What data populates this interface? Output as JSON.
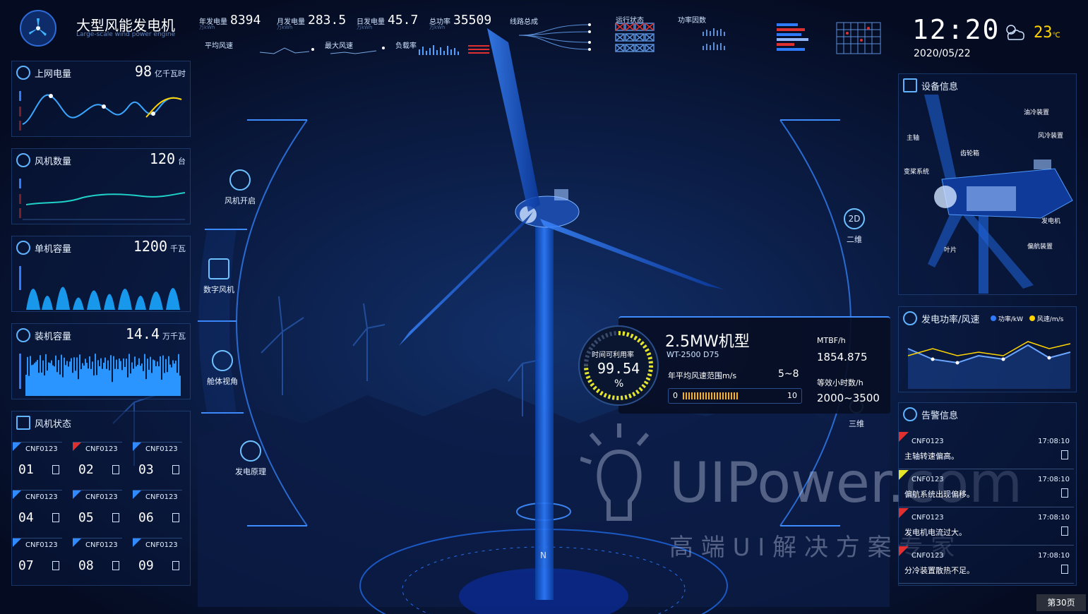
{
  "app": {
    "title": "大型风能发电机",
    "subtitle": "Large-scale wind power engine"
  },
  "topbar": {
    "metrics": [
      {
        "label": "年发电量",
        "value": "8394",
        "unit": "万kWh"
      },
      {
        "label": "月发电量",
        "value": "283.5",
        "unit": "万kWh"
      },
      {
        "label": "日发电量",
        "value": "45.7",
        "unit": "万kWh"
      },
      {
        "label": "总功率",
        "value": "35509",
        "unit": "万kWh"
      }
    ],
    "sublabels": {
      "avg_wind": "平均风速",
      "max_wind": "最大风速",
      "load_rate": "负载率"
    },
    "center_labels": {
      "line_total": "线路总成",
      "run_state": "运行状态",
      "power_factor": "功率因数"
    },
    "clock": {
      "time": "12:20",
      "date": "2020/05/22"
    },
    "weather": {
      "temp": "23",
      "unit": "℃"
    }
  },
  "left": {
    "panels": [
      {
        "title": "上网电量",
        "value": "98",
        "unit": "亿千瓦时"
      },
      {
        "title": "风机数量",
        "value": "120",
        "unit": "台"
      },
      {
        "title": "单机容量",
        "value": "1200",
        "unit": "千瓦"
      },
      {
        "title": "装机容量",
        "value": "14.4",
        "unit": "万千瓦"
      }
    ],
    "status_panel": {
      "title": "风机状态",
      "tiles": [
        {
          "id": "CNF0123",
          "num": "01",
          "flag_color": "#2f8bff"
        },
        {
          "id": "CNF0123",
          "num": "02",
          "flag_color": "#e03030"
        },
        {
          "id": "CNF0123",
          "num": "03",
          "flag_color": "#2f8bff"
        },
        {
          "id": "CNF0123",
          "num": "04",
          "flag_color": "#2f8bff"
        },
        {
          "id": "CNF0123",
          "num": "05",
          "flag_color": "#2f8bff"
        },
        {
          "id": "CNF0123",
          "num": "06",
          "flag_color": "#2f8bff"
        },
        {
          "id": "CNF0123",
          "num": "07",
          "flag_color": "#2f8bff"
        },
        {
          "id": "CNF0123",
          "num": "08",
          "flag_color": "#2f8bff"
        },
        {
          "id": "CNF0123",
          "num": "09",
          "flag_color": "#2f8bff"
        }
      ]
    }
  },
  "center": {
    "menu_left": [
      "风机开启",
      "数字风机",
      "舱体视角",
      "发电原理"
    ],
    "menu_right": [
      {
        "badge": "2D",
        "label": "二维"
      },
      {
        "badge": "",
        "label": "三维"
      }
    ],
    "card": {
      "model": "2.5MW机型",
      "sub": "WT-2500 D75",
      "gauge_label": "时间可利用率",
      "gauge_value": "99.54",
      "gauge_unit": "%",
      "range_label": "年平均风速范围m/s",
      "range_value": "5~8",
      "bar_min": "0",
      "bar_max": "10",
      "mtbf_label": "MTBF/h",
      "mtbf_value": "1854.875",
      "hours_label": "等效小时数/h",
      "hours_value": "2000~3500"
    },
    "compass": {
      "n": "N"
    },
    "watermark": {
      "brand": "UIPower.com",
      "slogan": "高 端 U I 解 决 方 案 专 家"
    }
  },
  "right": {
    "equipment": {
      "title": "设备信息",
      "labels": [
        "油冷装置",
        "主轴",
        "风冷装置",
        "齿轮箱",
        "变桨系统",
        "发电机",
        "叶片",
        "偏航装置"
      ]
    },
    "power_chart": {
      "title": "发电功率/风速",
      "legend": [
        {
          "name": "功率/kW",
          "color": "#2f7bff"
        },
        {
          "name": "风速/m/s",
          "color": "#ffd400"
        }
      ]
    },
    "alerts": {
      "title": "告警信息",
      "items": [
        {
          "id": "CNF0123",
          "time": "17:08:10",
          "msg": "主轴转速偏高。",
          "flag_color": "#e03030"
        },
        {
          "id": "CNF0123",
          "time": "17:08:10",
          "msg": "偏航系统出现偏移。",
          "flag_color": "#e5e52a"
        },
        {
          "id": "CNF0123",
          "time": "17:08:10",
          "msg": "发电机电流过大。",
          "flag_color": "#e03030"
        },
        {
          "id": "CNF0123",
          "time": "17:08:10",
          "msg": "分冷装置散热不足。",
          "flag_color": "#e03030"
        }
      ]
    }
  },
  "footer": {
    "page": "第30页"
  }
}
